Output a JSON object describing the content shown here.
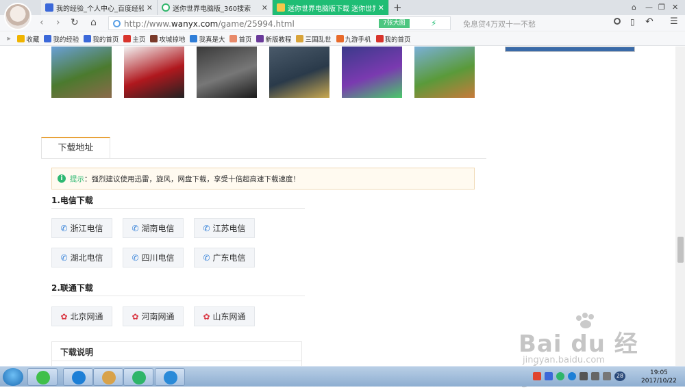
{
  "browser": {
    "tabs": [
      {
        "label": "我的经验_个人中心_百度经验",
        "active": false
      },
      {
        "label": "迷你世界电脑版_360搜索",
        "active": false
      },
      {
        "label": "迷你世界电脑版下载 迷你世界",
        "active": true
      }
    ],
    "close_glyph": "✕",
    "new_tab_glyph": "+",
    "window_controls": {
      "skin": "⌂",
      "min": "—",
      "max": "❐",
      "close": "✕"
    },
    "nav": {
      "back": "‹",
      "forward": "›",
      "refresh": "↻",
      "home": "⌂"
    },
    "url_prefix": "http://www.",
    "url_domain": "wanyx.com",
    "url_path": "/game/25994.html",
    "image_count_badge": "7张大图",
    "search_placeholder": "免息贷4万双十一不愁",
    "menu_glyph": "☰",
    "undo_glyph": "↶"
  },
  "bookmarks": [
    {
      "label": "收藏",
      "icon": "star-icon",
      "color": "#f0b400"
    },
    {
      "label": "我的经验",
      "icon": "baidu-icon",
      "color": "#3b68d9"
    },
    {
      "label": "我的首页",
      "icon": "baidu-icon",
      "color": "#3b68d9"
    },
    {
      "label": "主页",
      "icon": "home-red-icon",
      "color": "#d8342c"
    },
    {
      "label": "攻城掠地",
      "icon": "game-icon",
      "color": "#7a3a2a"
    },
    {
      "label": "我真是大",
      "icon": "c-icon",
      "color": "#2f7ed8"
    },
    {
      "label": "首页",
      "icon": "anime-icon",
      "color": "#e88a6a"
    },
    {
      "label": "新版教程",
      "icon": "game-icon",
      "color": "#6a3a9a"
    },
    {
      "label": "三国乱世",
      "icon": "game-icon",
      "color": "#d9a43a"
    },
    {
      "label": "九游手机",
      "icon": "nine-icon",
      "color": "#e86a2a"
    },
    {
      "label": "我的首页",
      "icon": "weibo-icon",
      "color": "#d8342c"
    }
  ],
  "thumbnails": [
    {
      "name": "minecraft",
      "colors": [
        "#6aa0d8",
        "#4b7a2e",
        "#8b6a4a"
      ]
    },
    {
      "name": "prototype",
      "colors": [
        "#f2f2f2",
        "#b0181e",
        "#222"
      ]
    },
    {
      "name": "band",
      "colors": [
        "#3a3a3a",
        "#777",
        "#1a1a1a"
      ]
    },
    {
      "name": "oxygen-not-included",
      "colors": [
        "#4a5a6a",
        "#2a3a4a",
        "#c8a850"
      ]
    },
    {
      "name": "minecraft-story",
      "colors": [
        "#3a3a8a",
        "#7a3ab0",
        "#4ac86a"
      ]
    },
    {
      "name": "adventure",
      "colors": [
        "#7ab0d8",
        "#5a9a3a",
        "#c87a3a"
      ]
    }
  ],
  "download": {
    "tab_label": "下载地址",
    "tip_label": "提示",
    "tip_text": "：强烈建议使用迅雷，旋风，网盘下载，享受十倍超高速下载速度！",
    "telecom_title": "1.电信下载",
    "telecom_buttons": [
      "浙江电信",
      "湖南电信",
      "江苏电信",
      "湖北电信",
      "四川电信",
      "广东电信"
    ],
    "unicom_title": "2.联通下载",
    "unicom_buttons": [
      "北京网通",
      "河南网通",
      "山东网通"
    ],
    "note_title": "下载说明"
  },
  "watermark": {
    "text": "Bai du 经验",
    "url": "jingyan.baidu.com"
  },
  "taskbar": {
    "apps": [
      "360-browser-icon",
      "kuaibo-icon",
      "paint-icon",
      "iqiyi-icon",
      "teamviewer-icon"
    ],
    "clock_time": "19:05",
    "clock_date": "2017/10/22",
    "tray_badge": "28"
  }
}
